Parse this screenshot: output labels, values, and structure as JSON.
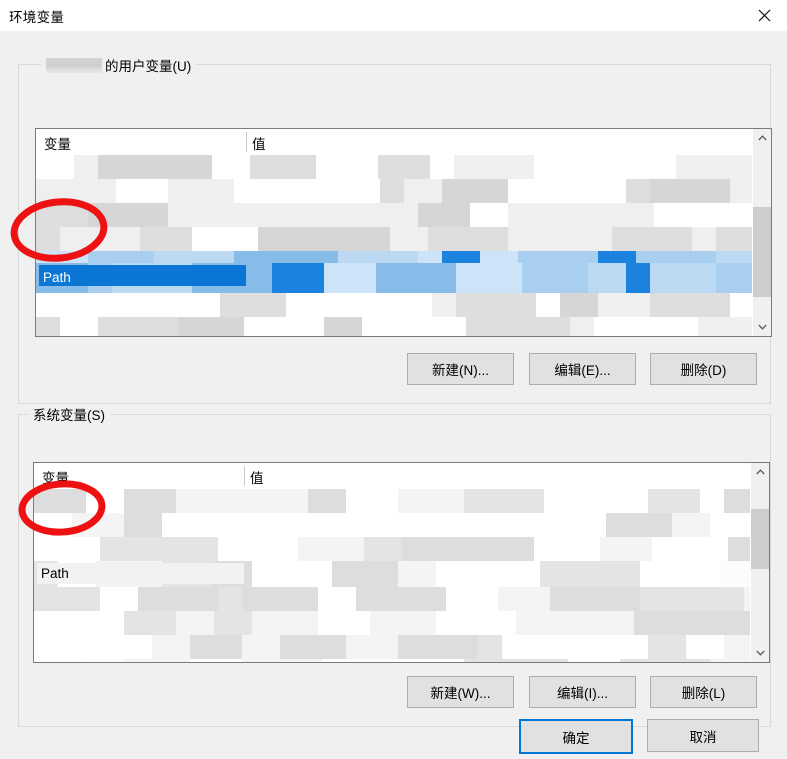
{
  "window": {
    "title": "环境变量",
    "close_icon": "close-icon"
  },
  "user_section": {
    "label_redacted_user": "",
    "label_suffix": "的用户变量(U)",
    "columns": {
      "variable": "变量",
      "value": "值"
    },
    "selected_row_name": "Path",
    "buttons": {
      "new": "新建(N)...",
      "edit": "编辑(E)...",
      "delete": "删除(D)"
    },
    "scrollbar": {
      "up_icon": "chevron-up-icon",
      "down_icon": "chevron-down-icon"
    }
  },
  "system_section": {
    "label": "系统变量(S)",
    "columns": {
      "variable": "变量",
      "value": "值"
    },
    "highlighted_row_name": "Path",
    "buttons": {
      "new": "新建(W)...",
      "edit": "编辑(I)...",
      "delete": "删除(L)"
    },
    "scrollbar": {
      "up_icon": "chevron-up-icon",
      "down_icon": "chevron-down-icon"
    }
  },
  "footer": {
    "ok": "确定",
    "cancel": "取消"
  },
  "colors": {
    "selection_blue": "#0c76d4",
    "accent_border": "#0078d7",
    "annotation_red": "#ee1111",
    "dialog_bg": "#f0f0f0"
  },
  "annotations": [
    {
      "name": "red-circle-user-path",
      "shape": "ellipse",
      "color": "#ee1111"
    },
    {
      "name": "red-circle-system-path",
      "shape": "ellipse",
      "color": "#ee1111"
    }
  ]
}
